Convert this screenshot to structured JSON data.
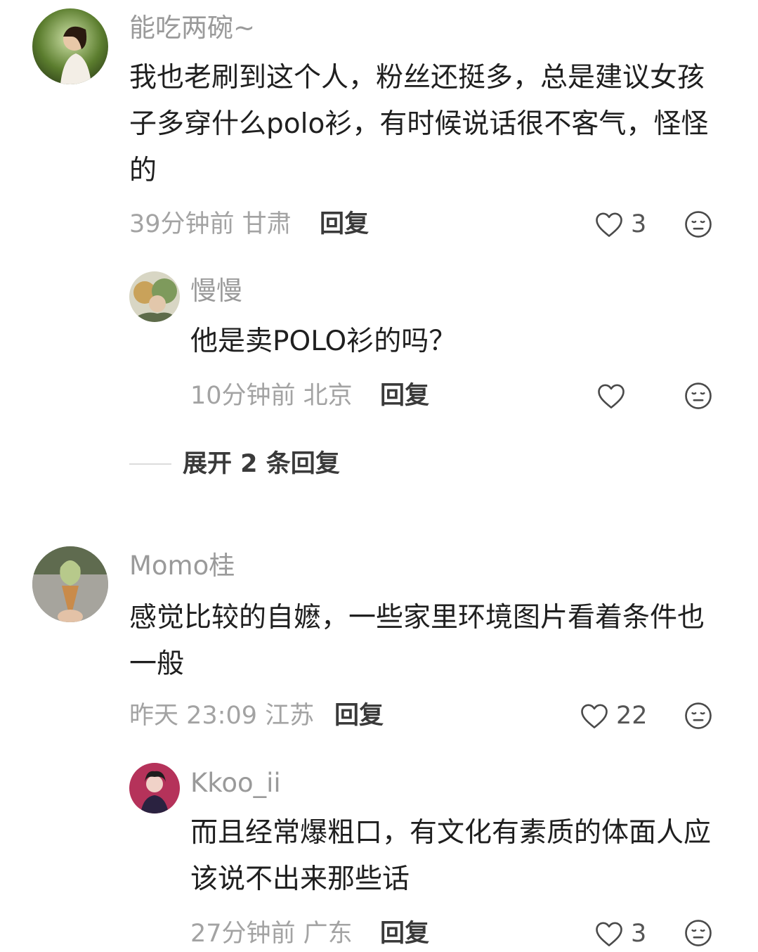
{
  "comments": [
    {
      "username": "能吃两碗~",
      "content": "我也老刷到这个人，粉丝还挺多，总是建议女孩子多穿什么polo衫，有时候说话很不客气，怪怪的",
      "time": "39分钟前 甘肃",
      "reply_label": "回复",
      "likes": "3",
      "replies": [
        {
          "username": "慢慢",
          "content": "他是卖POLO衫的吗？",
          "time": "10分钟前 北京",
          "reply_label": "回复",
          "likes": ""
        }
      ],
      "expand_label": "展开 2 条回复"
    },
    {
      "username": "Momo桂",
      "content": "感觉比较的自嬷，一些家里环境图片看着条件也一般",
      "time": "昨天 23:09 江苏",
      "reply_label": "回复",
      "likes": "22",
      "replies": [
        {
          "username": "Kkoo_ii",
          "content": "而且经常爆粗口，有文化有素质的体面人应该说不出来那些话",
          "time": "27分钟前 广东",
          "reply_label": "回复",
          "likes": "3"
        }
      ]
    }
  ],
  "icons": {
    "like": "heart-outline-icon",
    "dislike": "meh-face-icon"
  }
}
